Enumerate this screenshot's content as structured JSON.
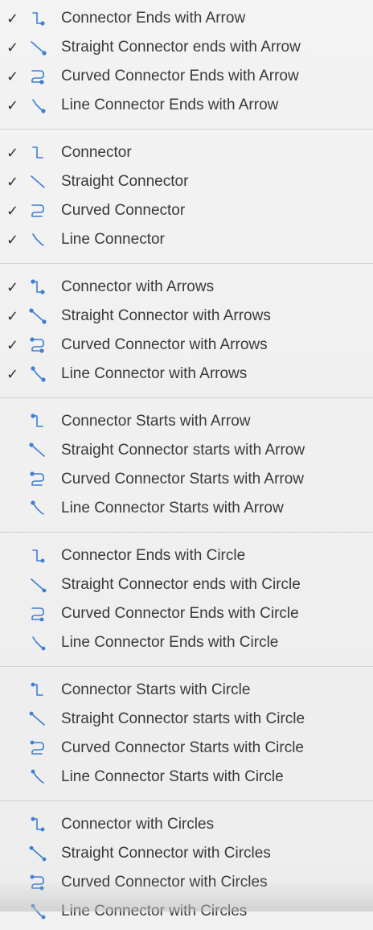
{
  "menu": {
    "check_glyph": "✓",
    "accent_color": "#3d7ed6",
    "groups": [
      {
        "items": [
          {
            "label": "Connector Ends with Arrow",
            "checked": true,
            "icon": "elbow-connector-end-arrow-icon"
          },
          {
            "label": "Straight Connector ends with Arrow",
            "checked": true,
            "icon": "straight-connector-end-arrow-icon"
          },
          {
            "label": "Curved Connector Ends with Arrow",
            "checked": true,
            "icon": "curved-connector-end-arrow-icon"
          },
          {
            "label": "Line Connector Ends with Arrow",
            "checked": true,
            "icon": "line-connector-end-arrow-icon"
          }
        ]
      },
      {
        "items": [
          {
            "label": "Connector",
            "checked": true,
            "icon": "elbow-connector-icon"
          },
          {
            "label": "Straight Connector",
            "checked": true,
            "icon": "straight-connector-icon"
          },
          {
            "label": "Curved Connector",
            "checked": true,
            "icon": "curved-connector-icon"
          },
          {
            "label": "Line Connector",
            "checked": true,
            "icon": "line-connector-icon"
          }
        ]
      },
      {
        "items": [
          {
            "label": "Connector with Arrows",
            "checked": true,
            "icon": "elbow-connector-arrows-icon"
          },
          {
            "label": "Straight Connector with Arrows",
            "checked": true,
            "icon": "straight-connector-arrows-icon"
          },
          {
            "label": "Curved Connector with Arrows",
            "checked": true,
            "icon": "curved-connector-arrows-icon"
          },
          {
            "label": "Line Connector with Arrows",
            "checked": true,
            "icon": "line-connector-arrows-icon"
          }
        ]
      },
      {
        "items": [
          {
            "label": "Connector Starts with Arrow",
            "checked": false,
            "icon": "elbow-connector-start-arrow-icon"
          },
          {
            "label": "Straight Connector starts with Arrow",
            "checked": false,
            "icon": "straight-connector-start-arrow-icon"
          },
          {
            "label": "Curved Connector Starts with Arrow",
            "checked": false,
            "icon": "curved-connector-start-arrow-icon"
          },
          {
            "label": "Line Connector Starts with Arrow",
            "checked": false,
            "icon": "line-connector-start-arrow-icon"
          }
        ]
      },
      {
        "items": [
          {
            "label": "Connector Ends with Circle",
            "checked": false,
            "icon": "elbow-connector-end-circle-icon"
          },
          {
            "label": "Straight Connector ends with Circle",
            "checked": false,
            "icon": "straight-connector-end-circle-icon"
          },
          {
            "label": "Curved Connector Ends with Circle",
            "checked": false,
            "icon": "curved-connector-end-circle-icon"
          },
          {
            "label": "Line Connector Ends with Circle",
            "checked": false,
            "icon": "line-connector-end-circle-icon"
          }
        ]
      },
      {
        "items": [
          {
            "label": "Connector Starts with Circle",
            "checked": false,
            "icon": "elbow-connector-start-circle-icon"
          },
          {
            "label": "Straight Connector starts with Circle",
            "checked": false,
            "icon": "straight-connector-start-circle-icon"
          },
          {
            "label": "Curved Connector Starts with Circle",
            "checked": false,
            "icon": "curved-connector-start-circle-icon"
          },
          {
            "label": "Line Connector Starts with Circle",
            "checked": false,
            "icon": "line-connector-start-circle-icon"
          }
        ]
      },
      {
        "items": [
          {
            "label": "Connector with Circles",
            "checked": false,
            "icon": "elbow-connector-circles-icon"
          },
          {
            "label": "Straight Connector with Circles",
            "checked": false,
            "icon": "straight-connector-circles-icon"
          },
          {
            "label": "Curved Connector with Circles",
            "checked": false,
            "icon": "curved-connector-circles-icon"
          },
          {
            "label": "Line Connector with Circles",
            "checked": false,
            "icon": "line-connector-circles-icon"
          }
        ]
      }
    ]
  }
}
